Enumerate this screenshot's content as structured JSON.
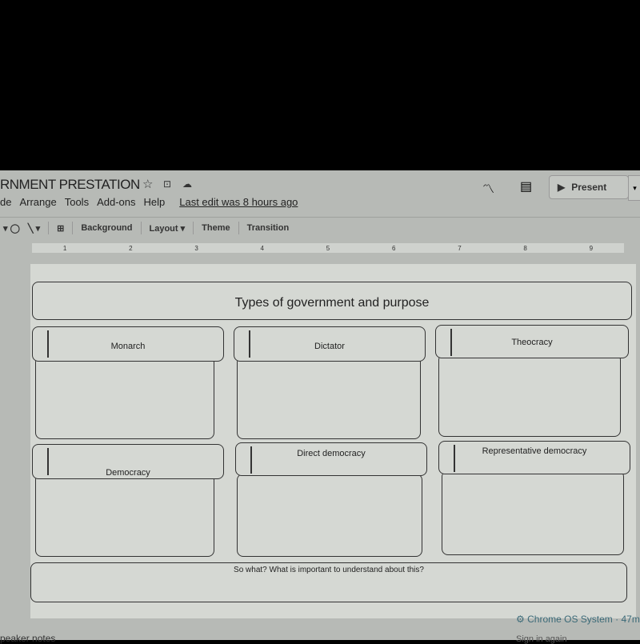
{
  "header": {
    "title": "RNMENT PRESTATION",
    "star_icon": "star-icon",
    "folder_icon": "move-to-folder-icon",
    "cloud_icon": "cloud-saved-icon",
    "present_label": "Present"
  },
  "menu": {
    "items": [
      "de",
      "Arrange",
      "Tools",
      "Add-ons",
      "Help"
    ],
    "last_edit": "Last edit was 8 hours ago"
  },
  "toolbar": {
    "background": "Background",
    "layout": "Layout",
    "theme": "Theme",
    "transition": "Transition"
  },
  "ruler": {
    "ticks": [
      "1",
      "2",
      "3",
      "4",
      "5",
      "6",
      "7",
      "8",
      "9"
    ]
  },
  "slide": {
    "title": "Types of government and purpose",
    "boxes": [
      "Monarch",
      "Dictator",
      "Theocracy",
      "Democracy",
      "Direct democracy",
      "Representative democracy"
    ],
    "footer": "So what? What is important to understand about this?"
  },
  "notification": {
    "source": "Chrome OS System",
    "time": "47m",
    "action": "Sign in again"
  },
  "notes": {
    "label": "peaker notes"
  }
}
